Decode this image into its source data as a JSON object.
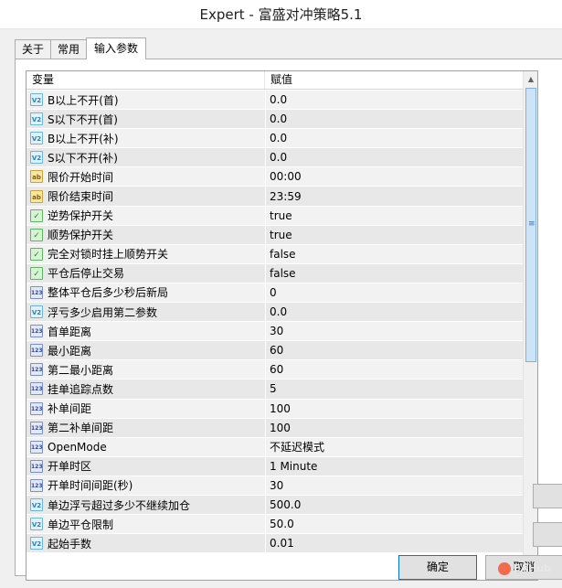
{
  "window": {
    "title": "Expert - 富盛对冲策略5.1"
  },
  "tabs": [
    {
      "label": "关于",
      "active": false
    },
    {
      "label": "常用",
      "active": false
    },
    {
      "label": "输入参数",
      "active": true
    }
  ],
  "grid": {
    "columns": {
      "variable": "变量",
      "value": "赋值"
    },
    "rows": [
      {
        "icon": "double-icon",
        "icon_text": "V2",
        "name": "B以上不开(首)",
        "value": "0.0"
      },
      {
        "icon": "double-icon",
        "icon_text": "V2",
        "name": "S以下不开(首)",
        "value": "0.0"
      },
      {
        "icon": "double-icon",
        "icon_text": "V2",
        "name": "B以上不开(补)",
        "value": "0.0"
      },
      {
        "icon": "double-icon",
        "icon_text": "V2",
        "name": "S以下不开(补)",
        "value": "0.0"
      },
      {
        "icon": "string-icon",
        "icon_text": "ab",
        "name": "限价开始时间",
        "value": "00:00"
      },
      {
        "icon": "string-icon",
        "icon_text": "ab",
        "name": "限价结束时间",
        "value": "23:59"
      },
      {
        "icon": "bool-icon",
        "icon_text": "✓",
        "name": "逆势保护开关",
        "value": "true"
      },
      {
        "icon": "bool-icon",
        "icon_text": "✓",
        "name": "顺势保护开关",
        "value": "true"
      },
      {
        "icon": "bool-icon",
        "icon_text": "✓",
        "name": "完全对锁时挂上顺势开关",
        "value": "false"
      },
      {
        "icon": "bool-icon",
        "icon_text": "✓",
        "name": "平仓后停止交易",
        "value": "false"
      },
      {
        "icon": "int-icon",
        "icon_text": "123",
        "name": "整体平仓后多少秒后新局",
        "value": "0"
      },
      {
        "icon": "double-icon",
        "icon_text": "V2",
        "name": "浮亏多少启用第二参数",
        "value": "0.0"
      },
      {
        "icon": "int-icon",
        "icon_text": "123",
        "name": "首单距离",
        "value": "30"
      },
      {
        "icon": "int-icon",
        "icon_text": "123",
        "name": "最小距离",
        "value": "60"
      },
      {
        "icon": "int-icon",
        "icon_text": "123",
        "name": "第二最小距离",
        "value": "60"
      },
      {
        "icon": "int-icon",
        "icon_text": "123",
        "name": "挂单追踪点数",
        "value": "5"
      },
      {
        "icon": "int-icon",
        "icon_text": "123",
        "name": "补单间距",
        "value": "100"
      },
      {
        "icon": "int-icon",
        "icon_text": "123",
        "name": "第二补单间距",
        "value": "100"
      },
      {
        "icon": "int-icon",
        "icon_text": "123",
        "name": "OpenMode",
        "value": "不延迟模式"
      },
      {
        "icon": "int-icon",
        "icon_text": "123",
        "name": "开单时区",
        "value": "1 Minute"
      },
      {
        "icon": "int-icon",
        "icon_text": "123",
        "name": "开单时间间距(秒)",
        "value": "30"
      },
      {
        "icon": "double-icon",
        "icon_text": "V2",
        "name": "单边浮亏超过多少不继续加仓",
        "value": "500.0"
      },
      {
        "icon": "double-icon",
        "icon_text": "V2",
        "name": "单边平仓限制",
        "value": "50.0"
      },
      {
        "icon": "double-icon",
        "icon_text": "V2",
        "name": "起始手数",
        "value": "0.01"
      }
    ]
  },
  "scrollbar": {
    "up_arrow": "▲",
    "down_arrow": "▼",
    "grip": "≡"
  },
  "buttons": {
    "ok": "确定",
    "cancel": "取消"
  },
  "watermark": {
    "text": "EAHub"
  }
}
